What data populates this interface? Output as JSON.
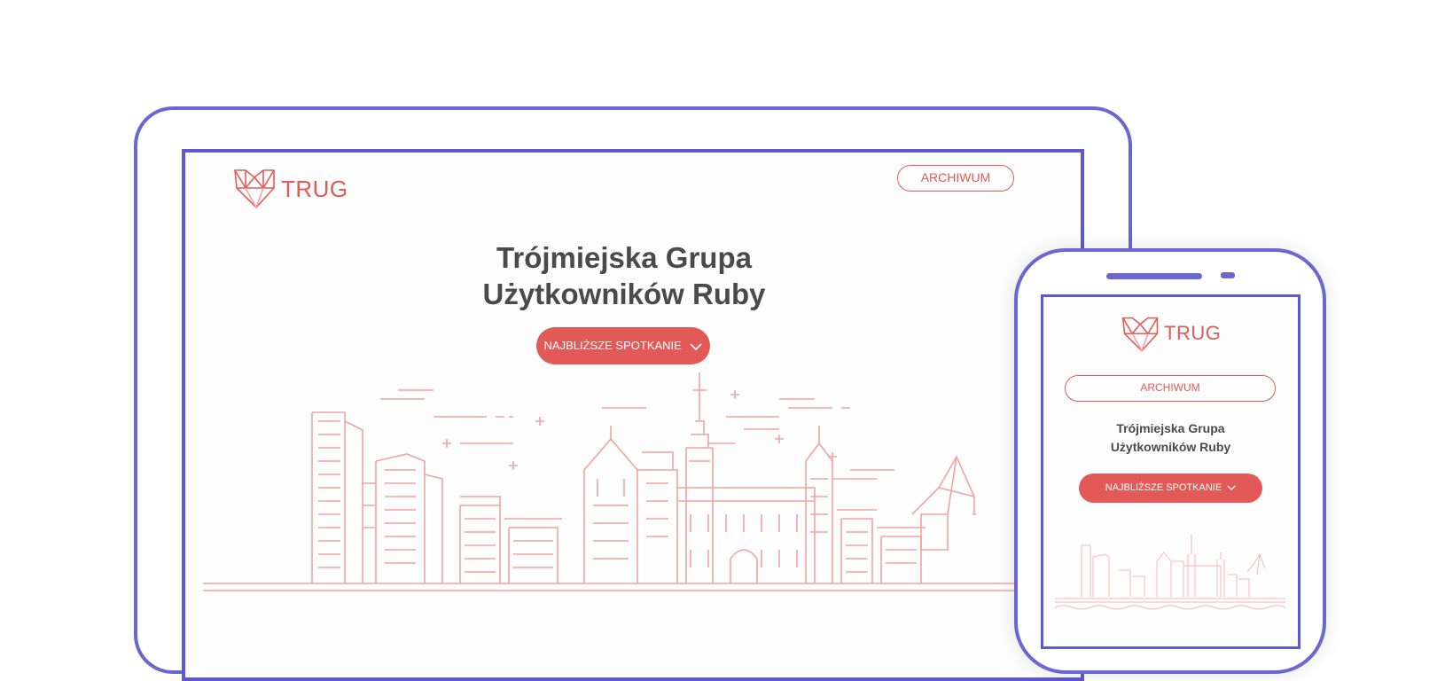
{
  "brand": {
    "name": "TRUG",
    "accent_color": "#e25a57",
    "frame_color": "#6a67d1",
    "logo_icon": "heart-bridge-icon"
  },
  "desktop": {
    "archive_button": "ARCHIWUM",
    "title_line1": "Trójmiejska Grupa",
    "title_line2": "Użytkowników Ruby",
    "cta_button": "NAJBLIŻSZE SPOTKANIE",
    "cta_icon": "chevron-down-icon"
  },
  "mobile": {
    "archive_button": "ARCHIWUM",
    "title_line1": "Trójmiejska Grupa",
    "title_line2": "Użytkowników Ruby",
    "cta_button": "NAJBLIŻSZE SPOTKANIE",
    "cta_icon": "chevron-down-icon"
  }
}
